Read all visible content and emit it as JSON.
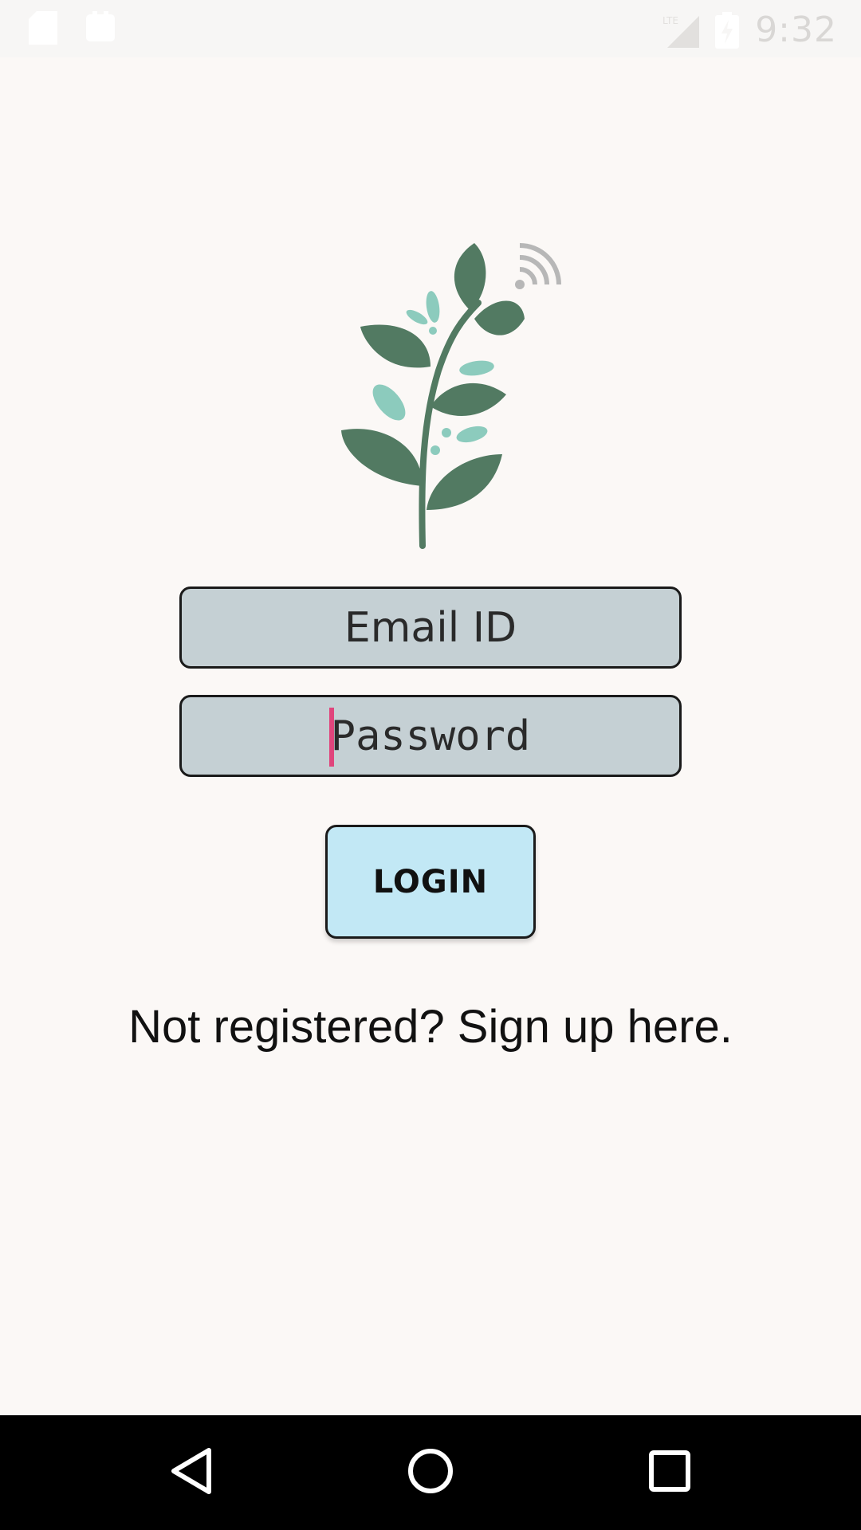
{
  "status_bar": {
    "time": "9:32",
    "network_label": "LTE",
    "left_icons": [
      "sd-card-icon",
      "notification-icon"
    ],
    "right_icons": [
      "lte-signal-icon",
      "battery-charging-icon"
    ]
  },
  "logo": {
    "icon": "plant-wifi-logo",
    "colors": {
      "leaf": "#527a62",
      "accent": "#8ccbbd",
      "signal": "#b7b7b7"
    }
  },
  "form": {
    "email_placeholder": "Email ID",
    "email_value": "",
    "password_placeholder": "Password",
    "password_value": ""
  },
  "login_button": {
    "label": "LOGIN"
  },
  "signup_link": {
    "text": "Not registered? Sign up here."
  },
  "nav_bar": {
    "icons": [
      "back-icon",
      "home-icon",
      "recents-icon"
    ]
  },
  "colors": {
    "background": "#fbf8f6",
    "field_fill": "#c5d0d4",
    "button_fill": "#c2e8f5",
    "cursor": "#e0457c"
  }
}
